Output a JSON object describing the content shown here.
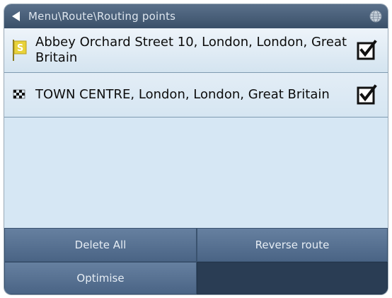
{
  "header": {
    "title": "Menu\\Route\\Routing points"
  },
  "points": [
    {
      "label": "Abbey Orchard Street 10, London, London, Great Britain",
      "icon": "start-flag-icon",
      "start_marker": "S",
      "checked": true
    },
    {
      "label": "TOWN CENTRE, London, London, Great Britain",
      "icon": "checkered-flag-icon",
      "checked": true
    }
  ],
  "buttons": {
    "delete_all": "Delete All",
    "reverse_route": "Reverse route",
    "optimise": "Optimise"
  },
  "colors": {
    "titlebar": "#3a5069",
    "list_bg": "#d6e7f4",
    "button": "#4a6485",
    "start_flag": "#e8d23a"
  }
}
